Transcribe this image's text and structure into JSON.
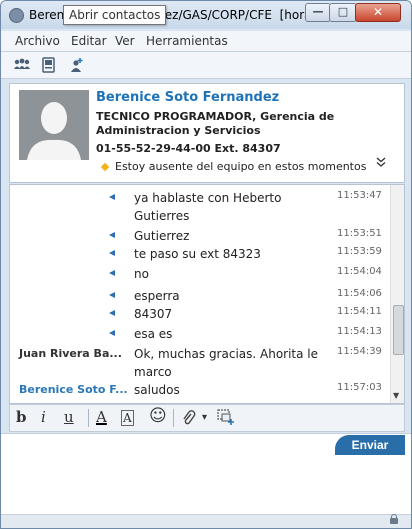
{
  "window": {
    "title": "Berenice Soto Fernandez/GAS/CORP/CFE  [hora d...",
    "tooltip": "Abrir contactos",
    "minimize_glyph": "—",
    "maximize_glyph": "□",
    "close_glyph": "✕"
  },
  "menu": {
    "items": [
      {
        "label": "Archivo"
      },
      {
        "label": "Editar"
      },
      {
        "label": "Ver"
      },
      {
        "label": "Herramientas"
      }
    ]
  },
  "toolbar": {
    "icons": [
      "contacts-icon",
      "contact-card-icon",
      "add-person-icon"
    ]
  },
  "contact": {
    "name": "Berenice Soto Fernandez",
    "title": "TECNICO PROGRAMADOR, Gerencia de Administracion y Servicios",
    "phone": "01-55-52-29-44-00 Ext. 84307",
    "status": "Estoy ausente del equipo en estos momentos",
    "status_color": "#f2b21a",
    "expand_glyph": "⌄⌄"
  },
  "chat": {
    "messages": [
      {
        "sender": "",
        "text": "ya hablaste con Heberto Gutierres",
        "time": "11:53:47"
      },
      {
        "sender": "",
        "text": "Gutierrez",
        "time": "11:53:51"
      },
      {
        "sender": "",
        "text": "te paso su ext 84323",
        "time": "11:53:59"
      },
      {
        "sender": "",
        "text": "no",
        "time": "11:54:04"
      },
      {
        "sender": "",
        "text": "esperra",
        "time": "11:54:06"
      },
      {
        "sender": "",
        "text": "84307",
        "time": "11:54:11"
      },
      {
        "sender": "",
        "text": "esa es",
        "time": "11:54:13"
      },
      {
        "sender": "Juan Rivera Ba...",
        "text": "Ok, muchas gracias. Ahorita le marco",
        "time": "11:54:39"
      },
      {
        "sender": "Berenice Soto F...",
        "text": "saludos",
        "time": "11:57:03"
      }
    ]
  },
  "format": {
    "bold": "b",
    "italic": "i",
    "underline": "u",
    "font_color": "A",
    "highlight": "A",
    "emoticon": "☺",
    "attach": "⊘",
    "dropdown": "▾"
  },
  "input": {
    "send_label": "Enviar",
    "accent": "#2a6ea9"
  }
}
